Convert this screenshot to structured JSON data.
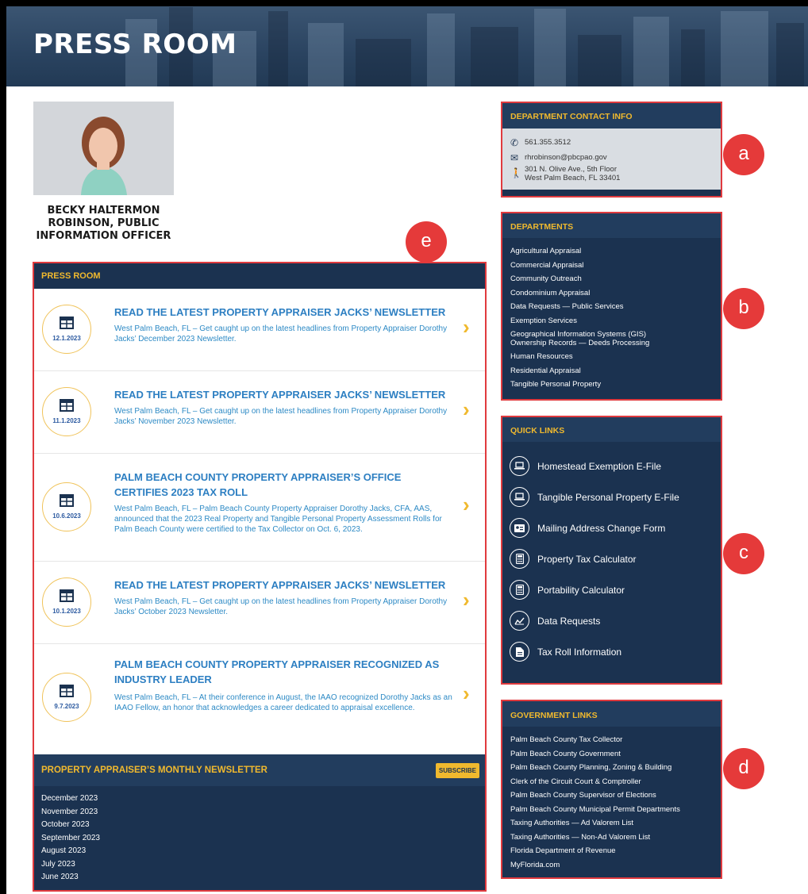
{
  "header": {
    "title": "PRESS ROOM"
  },
  "profile": {
    "name": "BECKY HALTERMON ROBINSON, PUBLIC INFORMATION OFFICER"
  },
  "press_room": {
    "title": "PRESS ROOM",
    "items": [
      {
        "date": "12.1.2023",
        "title": "READ THE LATEST PROPERTY APPRAISER JACKS’ NEWSLETTER",
        "excerpt": "West Palm Beach, FL – Get caught up on the latest headlines from Property Appraiser Dorothy Jacks’ December 2023 Newsletter."
      },
      {
        "date": "11.1.2023",
        "title": "READ THE LATEST PROPERTY APPRAISER JACKS’ NEWSLETTER",
        "excerpt": "West Palm Beach, FL – Get caught up on the latest headlines from Property Appraiser Dorothy Jacks’ November 2023 Newsletter."
      },
      {
        "date": "10.6.2023",
        "title": "PALM BEACH COUNTY PROPERTY APPRAISER’S OFFICE CERTIFIES 2023 TAX ROLL",
        "excerpt": "West Palm Beach, FL – Palm Beach County Property Appraiser Dorothy Jacks, CFA, AAS, announced that the 2023 Real Property and Tangible Personal Property Assessment Rolls for Palm Beach County were certified to the Tax Collector on Oct. 6, 2023."
      },
      {
        "date": "10.1.2023",
        "title": "READ THE LATEST PROPERTY APPRAISER JACKS’ NEWSLETTER",
        "excerpt": "West Palm Beach, FL – Get caught up on the latest headlines from Property Appraiser Dorothy Jacks’ October 2023 Newsletter."
      },
      {
        "date": "9.7.2023",
        "title": "PALM BEACH COUNTY PROPERTY APPRAISER RECOGNIZED AS INDUSTRY LEADER",
        "excerpt": "West Palm Beach, FL – At their conference in August, the IAAO recognized Dorothy Jacks as an IAAO Fellow, an honor that acknowledges a career dedicated to appraisal excellence."
      }
    ]
  },
  "newsletter": {
    "title": "PROPERTY APPRAISER’S MONTHLY NEWSLETTER",
    "subscribe_label": "SUBSCRIBE",
    "months": [
      "December 2023",
      "November 2023",
      "October 2023",
      "September 2023",
      "August 2023",
      "July 2023",
      "June 2023"
    ]
  },
  "contact": {
    "title": "DEPARTMENT CONTACT INFO",
    "phone": "561.355.3512",
    "email": "rhrobinson@pbcpao.gov",
    "address_line1": "301 N. Olive Ave., 5th Floor",
    "address_line2": "West Palm Beach, FL 33401"
  },
  "departments": {
    "title": "DEPARTMENTS",
    "items": [
      "Agricultural Appraisal",
      "Commercial Appraisal",
      "Community Outreach",
      "Condominium Appraisal",
      "Data Requests — Public Services",
      "Exemption Services",
      "Geographical Information Systems (GIS)",
      "Ownership Records — Deeds Processing",
      "Human Resources",
      "Residential Appraisal",
      "Tangible Personal Property"
    ]
  },
  "quick_links": {
    "title": "QUICK LINKS",
    "items": [
      {
        "label": "Homestead Exemption E-File",
        "icon": "laptop-icon"
      },
      {
        "label": "Tangible Personal Property E-File",
        "icon": "laptop-icon"
      },
      {
        "label": "Mailing Address Change Form",
        "icon": "id-card-icon"
      },
      {
        "label": "Property Tax Calculator",
        "icon": "calculator-icon"
      },
      {
        "label": "Portability Calculator",
        "icon": "calculator-icon"
      },
      {
        "label": "Data Requests",
        "icon": "chart-icon"
      },
      {
        "label": "Tax Roll Information",
        "icon": "document-icon"
      }
    ]
  },
  "government_links": {
    "title": "GOVERNMENT LINKS",
    "items": [
      "Palm Beach County Tax Collector",
      "Palm Beach County Government",
      "Palm Beach County Planning, Zoning & Building",
      "Clerk of the Circuit Court & Comptroller",
      "Palm Beach County Supervisor of Elections",
      "Palm Beach County Municipal Permit Departments",
      "Taxing Authorities — Ad Valorem List",
      "Taxing Authorities — Non-Ad Valorem List",
      "Florida Department of Revenue",
      "MyFlorida.com"
    ]
  },
  "annotations": [
    "a",
    "b",
    "c",
    "d",
    "e"
  ],
  "colors": {
    "navy": "#1b3250",
    "gold": "#f0b92e",
    "link_blue": "#2d7fc2",
    "highlight_red": "#e03a3e"
  }
}
